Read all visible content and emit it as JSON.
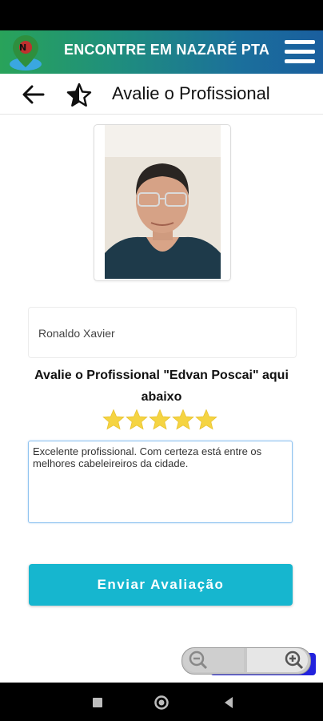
{
  "app": {
    "title": "ENCONTRE EM NAZARÉ PTA"
  },
  "toolbar": {
    "title": "Avalie o Profissional"
  },
  "profile": {
    "photo_alt": "Foto do profissional"
  },
  "form": {
    "name_value": "Ronaldo Xavier",
    "prompt": "Avalie o Profissional \"Edvan Poscai\" aqui abaixo",
    "rating": 5,
    "rating_max": 5,
    "review_text": "Excelente profissional. Com certeza está entre os melhores cabeleireiros da cidade.",
    "submit_label": "Enviar Avaliação"
  },
  "colors": {
    "header_start": "#29a35a",
    "header_end": "#1a5e9e",
    "accent_button": "#16b6cf",
    "star": "#f5d442"
  },
  "icons": {
    "back": "arrow-left-icon",
    "favorite": "star-half-icon",
    "menu": "hamburger-icon",
    "zoom_out": "zoom-out-icon",
    "zoom_in": "zoom-in-icon"
  }
}
